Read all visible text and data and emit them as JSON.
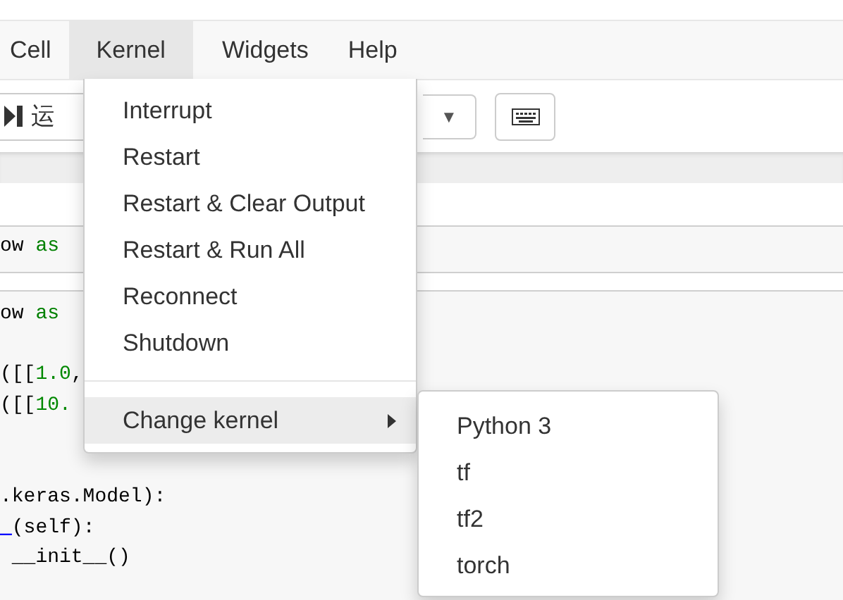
{
  "menubar": [
    {
      "label": "Cell",
      "selected": false
    },
    {
      "label": "Kernel",
      "selected": true
    },
    {
      "label": "Widgets",
      "selected": false
    },
    {
      "label": "Help",
      "selected": false
    }
  ],
  "toolbar": {
    "run_button": {
      "label": "运"
    },
    "dropdown_arrow": "▼"
  },
  "cells": [
    {
      "lines": [
        [
          {
            "t": "ow ",
            "kind": "plain"
          },
          {
            "t": "as",
            "kind": "kw"
          }
        ]
      ]
    },
    {
      "lines": [
        [
          {
            "t": "ow ",
            "kind": "plain"
          },
          {
            "t": "as",
            "kind": "kw"
          }
        ],
        [
          {
            "t": "([[",
            "kind": "plain"
          },
          {
            "t": "1.0",
            "kind": "num"
          },
          {
            "t": ",",
            "kind": "plain"
          }
        ],
        [
          {
            "t": "([[",
            "kind": "plain"
          },
          {
            "t": "10.",
            "kind": "num"
          }
        ],
        [
          {
            "t": ".keras.Model):",
            "kind": "plain"
          }
        ],
        [
          {
            "t": "_",
            "kind": "name"
          },
          {
            "t": "(self):",
            "kind": "plain"
          }
        ],
        [
          {
            "t": " __init__()",
            "kind": "plain"
          }
        ]
      ]
    }
  ],
  "kernel_menu": {
    "items": [
      {
        "label": "Interrupt",
        "kind": "item"
      },
      {
        "label": "Restart",
        "kind": "item"
      },
      {
        "label": "Restart & Clear Output",
        "kind": "item"
      },
      {
        "label": "Restart & Run All",
        "kind": "item"
      },
      {
        "label": "Reconnect",
        "kind": "item"
      },
      {
        "label": "Shutdown",
        "kind": "item"
      },
      {
        "kind": "divider"
      },
      {
        "label": "Change kernel",
        "kind": "submenu",
        "selected": true
      }
    ],
    "submenu": {
      "items": [
        "Python 3",
        "tf",
        "tf2",
        "torch"
      ]
    }
  }
}
